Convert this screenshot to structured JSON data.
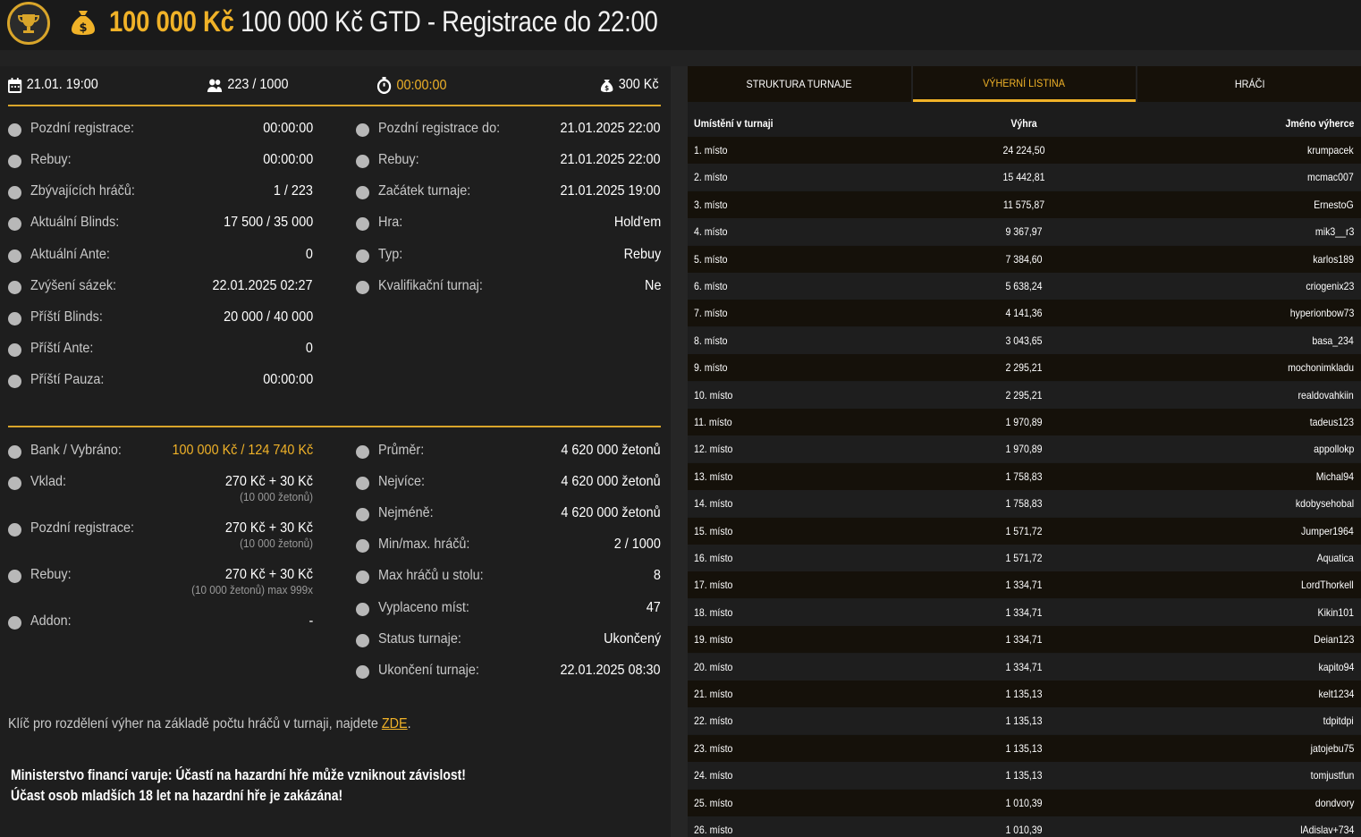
{
  "header": {
    "prize_gold": "100 000 Kč",
    "title_rest": "100 000 Kč GTD - Registrace do 22:00"
  },
  "summary": {
    "date": "21.01. 19:00",
    "players": "223 / 1000",
    "timer": "00:00:00",
    "buyin": "300 Kč"
  },
  "info_left": [
    {
      "label": "Pozdní registrace:",
      "value": "00:00:00",
      "icon": "user-icon"
    },
    {
      "label": "Rebuy:",
      "value": "00:00:00",
      "icon": "chips-icon"
    },
    {
      "label": "Zbývajících hráčů:",
      "value": "1 / 223",
      "icon": "users-icon"
    },
    {
      "label": "Aktuální Blinds:",
      "value": "17 500 / 35 000",
      "icon": "chips-icon"
    },
    {
      "label": "Aktuální Ante:",
      "value": "0",
      "icon": "coin-icon"
    },
    {
      "label": "Zvýšení sázek:",
      "value": "22.01.2025 02:27",
      "icon": "arrow-up-icon"
    },
    {
      "label": "Příští Blinds:",
      "value": "20 000 / 40 000",
      "icon": "chips-icon"
    },
    {
      "label": "Příští Ante:",
      "value": "0",
      "icon": "coin-icon"
    },
    {
      "label": "Příští Pauza:",
      "value": "00:00:00",
      "icon": "clock-icon"
    }
  ],
  "info_right": [
    {
      "label": "Pozdní registrace do:",
      "value": "21.01.2025 22:00",
      "icon": "user-icon"
    },
    {
      "label": "Rebuy:",
      "value": "21.01.2025 22:00",
      "icon": "chips-icon"
    },
    {
      "label": "Začátek turnaje:",
      "value": "21.01.2025 19:00",
      "icon": "flag-icon"
    },
    {
      "label": "Hra:",
      "value": "Hold'em",
      "icon": "cards-icon"
    },
    {
      "label": "Typ:",
      "value": "Rebuy",
      "icon": "grid-icon"
    },
    {
      "label": "Kvalifikační turnaj:",
      "value": "Ne",
      "icon": "medal-icon"
    }
  ],
  "money_left": [
    {
      "label": "Bank / Vybráno:",
      "value": "100 000 Kč / 124 740 Kč",
      "sub": "",
      "icon": "bag-icon"
    },
    {
      "label": "Vklad:",
      "value": "270 Kč + 30 Kč",
      "sub": "(10 000 žetonů)",
      "icon": "chips-icon"
    },
    {
      "label": "Pozdní registrace:",
      "value": "270 Kč + 30 Kč",
      "sub": "(10 000 žetonů)",
      "icon": "coin-icon"
    },
    {
      "label": "Rebuy:",
      "value": "270 Kč + 30 Kč",
      "sub": "(10 000 žetonů) max 999x",
      "icon": "chips-icon"
    },
    {
      "label": "Addon:",
      "value": "-",
      "sub": "",
      "icon": "coin-icon"
    }
  ],
  "money_right": [
    {
      "label": "Průměr:",
      "value": "4 620 000 žetonů",
      "icon": "chip-icon"
    },
    {
      "label": "Nejvíce:",
      "value": "4 620 000 žetonů",
      "icon": "chip-icon"
    },
    {
      "label": "Nejméně:",
      "value": "4 620 000 žetonů",
      "icon": "chip-icon"
    },
    {
      "label": "Min/max. hráčů:",
      "value": "2 / 1000",
      "icon": "users-icon"
    },
    {
      "label": "Max hráčů u stolu:",
      "value": "8",
      "icon": "table-icon"
    },
    {
      "label": "Vyplaceno míst:",
      "value": "47",
      "icon": "trophy-icon"
    },
    {
      "label": "Status turnaje:",
      "value": "Ukončený",
      "icon": "info-icon"
    },
    {
      "label": "Ukončení turnaje:",
      "value": "22.01.2025 08:30",
      "icon": "flag-icon"
    }
  ],
  "note": {
    "text": "Klíč pro rozdělení výher na základě počtu hráčů v turnaji, najdete ",
    "link": "ZDE",
    "end": "."
  },
  "warning": {
    "line1": "Ministerstvo financí varuje: Účastí na hazardní hře může vzniknout závislost!",
    "line2": "Účast osob mladších 18 let na hazardní hře je zakázána!"
  },
  "tabs": [
    "STRUKTURA TURNAJE",
    "VÝHERNÍ LISTINA",
    "HRÁČI"
  ],
  "table": {
    "headers": [
      "Umístění v turnaji",
      "Výhra",
      "Jméno výherce"
    ],
    "rows": [
      [
        "1. místo",
        "24 224,50",
        "krumpacek"
      ],
      [
        "2. místo",
        "15 442,81",
        "mcmac007"
      ],
      [
        "3. místo",
        "11 575,87",
        "ErnestoG"
      ],
      [
        "4. místo",
        "9 367,97",
        "mik3__r3"
      ],
      [
        "5. místo",
        "7 384,60",
        "karlos189"
      ],
      [
        "6. místo",
        "5 638,24",
        "criogenix23"
      ],
      [
        "7. místo",
        "4 141,36",
        "hyperionbow73"
      ],
      [
        "8. místo",
        "3 043,65",
        "basa_234"
      ],
      [
        "9. místo",
        "2 295,21",
        "mochonimkladu"
      ],
      [
        "10. místo",
        "2 295,21",
        "realdovahkiin"
      ],
      [
        "11. místo",
        "1 970,89",
        "tadeus123"
      ],
      [
        "12. místo",
        "1 970,89",
        "appollokp"
      ],
      [
        "13. místo",
        "1 758,83",
        "Michal94"
      ],
      [
        "14. místo",
        "1 758,83",
        "kdobysehobal"
      ],
      [
        "15. místo",
        "1 571,72",
        "Jumper1964"
      ],
      [
        "16. místo",
        "1 571,72",
        "Aquatica"
      ],
      [
        "17. místo",
        "1 334,71",
        "LordThorkell"
      ],
      [
        "18. místo",
        "1 334,71",
        "Kikin101"
      ],
      [
        "19. místo",
        "1 334,71",
        "Deian123"
      ],
      [
        "20. místo",
        "1 334,71",
        "kapito94"
      ],
      [
        "21. místo",
        "1 135,13",
        "kelt1234"
      ],
      [
        "22. místo",
        "1 135,13",
        "tdpitdpi"
      ],
      [
        "23. místo",
        "1 135,13",
        "jatojebu75"
      ],
      [
        "24. místo",
        "1 135,13",
        "tomjustfun"
      ],
      [
        "25. místo",
        "1 010,39",
        "dondvory"
      ],
      [
        "26. místo",
        "1 010,39",
        "lAdislav+734"
      ]
    ]
  },
  "colors": {
    "accent": "#f0b228",
    "bg": "#1e1e1e",
    "row_dark": "#15110a"
  }
}
